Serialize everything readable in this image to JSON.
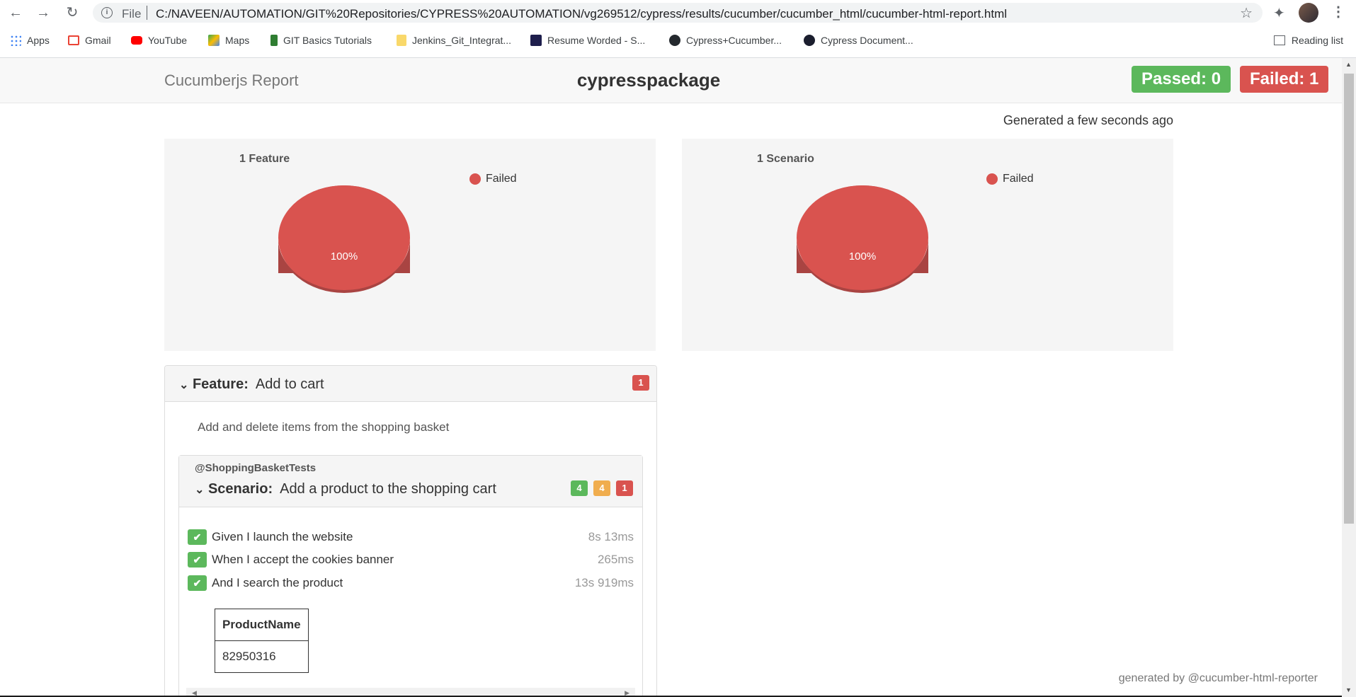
{
  "browser": {
    "scheme": "File",
    "url": "C:/NAVEEN/AUTOMATION/GIT%20Repositories/CYPRESS%20AUTOMATION/vg269512/cypress/results/cucumber/cucumber_html/cucumber-html-report.html",
    "bookmarks": [
      {
        "label": "Apps",
        "color": "#4285f4"
      },
      {
        "label": "Gmail",
        "color": "#ea4335"
      },
      {
        "label": "YouTube",
        "color": "#ff0000"
      },
      {
        "label": "Maps",
        "color": "#34a853"
      },
      {
        "label": "GIT Basics Tutorials",
        "color": "#2f7d32"
      },
      {
        "label": "Jenkins_Git_Integrat...",
        "color": "#f9d86a"
      },
      {
        "label": "Resume Worded - S...",
        "color": "#1e1e4c"
      },
      {
        "label": "Cypress+Cucumber...",
        "color": "#24292e"
      },
      {
        "label": "Cypress Document...",
        "color": "#1b1e2e"
      }
    ],
    "reading_list": "Reading list"
  },
  "report": {
    "brand": "Cucumberjs Report",
    "package": "cypresspackage",
    "passed": "Passed: 0",
    "failed": "Failed: 1",
    "generated": "Generated a few seconds ago",
    "footer": "generated by @cucumber-html-reporter"
  },
  "charts": [
    {
      "title": "1 Feature",
      "legend": "Failed",
      "label": "100%",
      "failed_pct": 100,
      "color": "#d9534f"
    },
    {
      "title": "1 Scenario",
      "legend": "Failed",
      "label": "100%",
      "failed_pct": 100,
      "color": "#d9534f"
    }
  ],
  "feature": {
    "keyword": "Feature:",
    "name": "Add to cart",
    "count": "1",
    "description": "Add and delete items from the shopping basket",
    "scenario": {
      "tag": "@ShoppingBasketTests",
      "keyword": "Scenario:",
      "name": "Add a product to the shopping cart",
      "counts": {
        "passed": "4",
        "skipped": "4",
        "failed": "1"
      },
      "steps": [
        {
          "text": "Given I launch the website",
          "duration": "8s 13ms"
        },
        {
          "text": "When I accept the cookies banner",
          "duration": "265ms"
        },
        {
          "text": "And I search the product",
          "duration": "13s 919ms"
        }
      ],
      "table": {
        "header": "ProductName",
        "value": "82950316"
      }
    }
  }
}
